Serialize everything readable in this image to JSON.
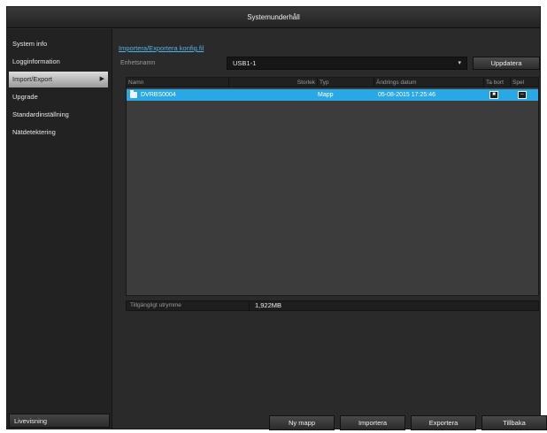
{
  "window": {
    "title": "Systemunderhåll"
  },
  "sidebar": {
    "items": [
      {
        "label": "System info"
      },
      {
        "label": "Logginformation"
      },
      {
        "label": "Import/Export",
        "active": true
      },
      {
        "label": "Upgrade"
      },
      {
        "label": "Standardinställning"
      },
      {
        "label": "Nätdetektering"
      }
    ],
    "bottom_label": "Livevisning",
    "active_arrow": "▶"
  },
  "main": {
    "breadcrumb": "Importera/Exportera konfig.fil",
    "device": {
      "label": "Enhetsnamn",
      "value": "USB1-1",
      "dropdown_icon": "▾"
    },
    "refresh_label": "Uppdatera",
    "table": {
      "columns": [
        "Namn",
        "Storlek",
        "Typ",
        "Ändrings datum",
        "Ta bort",
        "Spel"
      ],
      "rows": [
        {
          "name": "DVRBS0004",
          "size": "",
          "type": "Mapp",
          "date": "05-08-2015 17:25:46",
          "delete_icon": "■",
          "play_icon": "–"
        }
      ]
    },
    "free_space": {
      "label": "Tillgängligt utrymme",
      "value": "1,922MB"
    },
    "buttons": {
      "new_folder": "Ny mapp",
      "import": "Importera",
      "export": "Exportera",
      "back": "Tillbaka"
    }
  },
  "colors": {
    "accent": "#29a8e6",
    "link": "#4fb4e6",
    "background": "#2a2a2a"
  },
  "icons": [
    "folder-icon",
    "chevron-right-icon",
    "dropdown-arrow-icon",
    "delete-icon",
    "play-icon"
  ]
}
